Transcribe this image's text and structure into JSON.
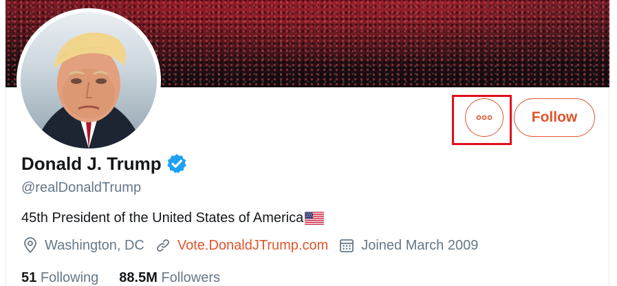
{
  "profile": {
    "name": "Donald J. Trump",
    "handle": "@realDonaldTrump",
    "bio": "45th President of the United States of America",
    "bio_emoji": "us-flag",
    "location": "Washington, DC",
    "website": "Vote.DonaldJTrump.com",
    "joined": "Joined March 2009",
    "verified": true
  },
  "stats": {
    "following_count": "51",
    "following_label": "Following",
    "followers_count": "88.5M",
    "followers_label": "Followers"
  },
  "actions": {
    "follow_label": "Follow",
    "more_icon": "more-options-icon"
  },
  "colors": {
    "accent": "#e0542b",
    "highlight": "#e00d1c",
    "verified": "#1da1f2",
    "muted": "#657786",
    "text": "#14171a"
  }
}
